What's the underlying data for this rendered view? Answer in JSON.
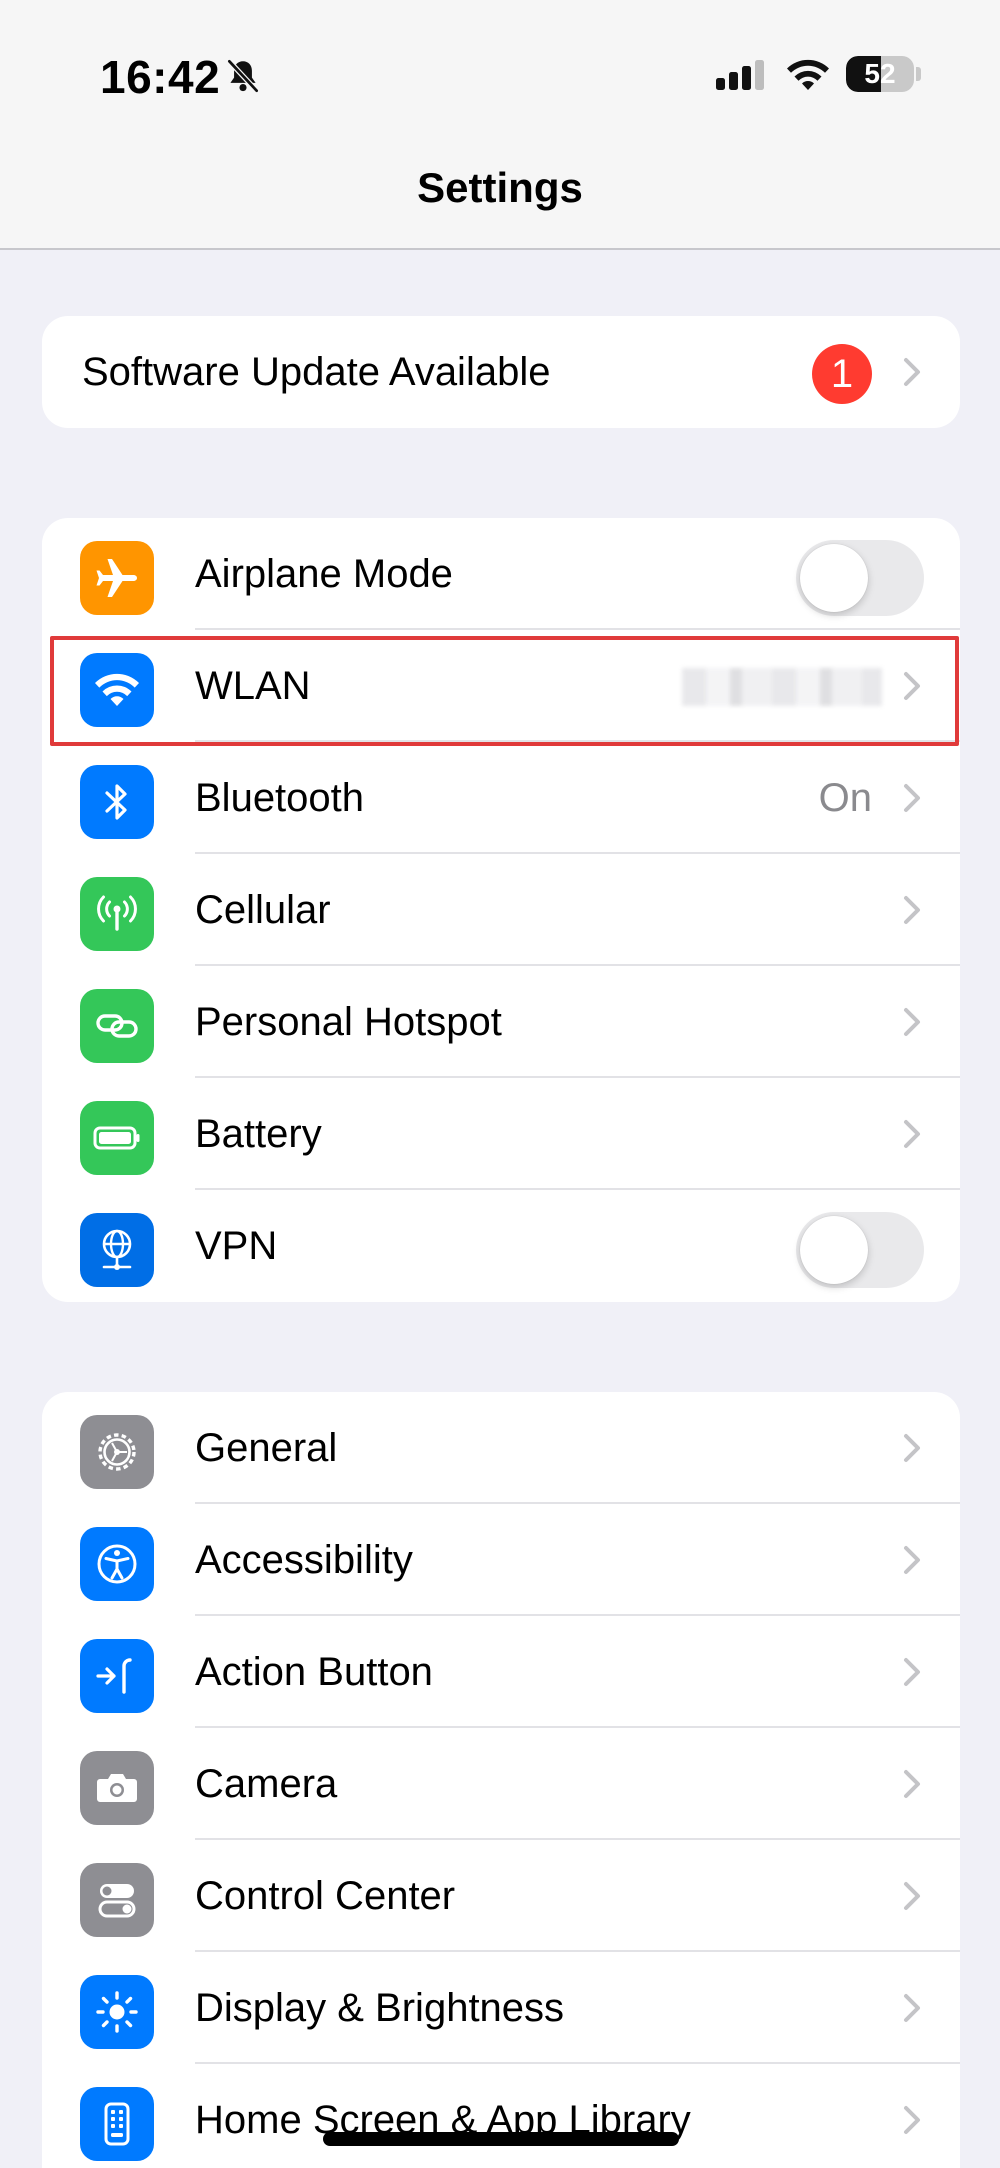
{
  "status_bar": {
    "time": "16:42",
    "battery_level": "52",
    "battery_fraction": 0.52,
    "icons": [
      "bell-slash-icon",
      "cellular-signal-icon",
      "wifi-icon",
      "battery-icon"
    ]
  },
  "nav": {
    "title": "Settings"
  },
  "update_group": {
    "label": "Software Update Available",
    "badge": "1",
    "badge_color": "#ff3b30"
  },
  "connectivity_group": [
    {
      "id": "airplane",
      "label": "Airplane Mode",
      "icon": "airplane-icon",
      "color": "#ff9500",
      "control": "toggle",
      "on": false
    },
    {
      "id": "wlan",
      "label": "WLAN",
      "icon": "wifi-icon",
      "color": "#007aff",
      "control": "chevron",
      "value_blurred": true,
      "highlighted": true
    },
    {
      "id": "bluetooth",
      "label": "Bluetooth",
      "icon": "bluetooth-icon",
      "color": "#007aff",
      "control": "chevron",
      "value": "On"
    },
    {
      "id": "cellular",
      "label": "Cellular",
      "icon": "antenna-icon",
      "color": "#34c759",
      "control": "chevron"
    },
    {
      "id": "hotspot",
      "label": "Personal Hotspot",
      "icon": "link-icon",
      "color": "#34c759",
      "control": "chevron"
    },
    {
      "id": "battery",
      "label": "Battery",
      "icon": "battery-icon",
      "color": "#34c759",
      "control": "chevron"
    },
    {
      "id": "vpn",
      "label": "VPN",
      "icon": "globe-icon",
      "color": "#006ee6",
      "control": "toggle",
      "on": false
    }
  ],
  "system_group": [
    {
      "id": "general",
      "label": "General",
      "icon": "gear-icon",
      "color": "#8e8e93"
    },
    {
      "id": "accessibility",
      "label": "Accessibility",
      "icon": "accessibility-icon",
      "color": "#007aff"
    },
    {
      "id": "action-button",
      "label": "Action Button",
      "icon": "action-button-icon",
      "color": "#007aff"
    },
    {
      "id": "camera",
      "label": "Camera",
      "icon": "camera-icon",
      "color": "#8e8e93"
    },
    {
      "id": "control-center",
      "label": "Control Center",
      "icon": "switches-icon",
      "color": "#8e8e93"
    },
    {
      "id": "display",
      "label": "Display & Brightness",
      "icon": "sun-icon",
      "color": "#007aff"
    },
    {
      "id": "home-screen",
      "label": "Home Screen & App Library",
      "icon": "phone-grid-icon",
      "color": "#007aff"
    }
  ],
  "colors": {
    "background": "#f0f0f7",
    "cell": "#ffffff",
    "separator": "#e2e2e6",
    "secondary_text": "#8a8a8e",
    "highlight_border": "#e03a3a"
  }
}
